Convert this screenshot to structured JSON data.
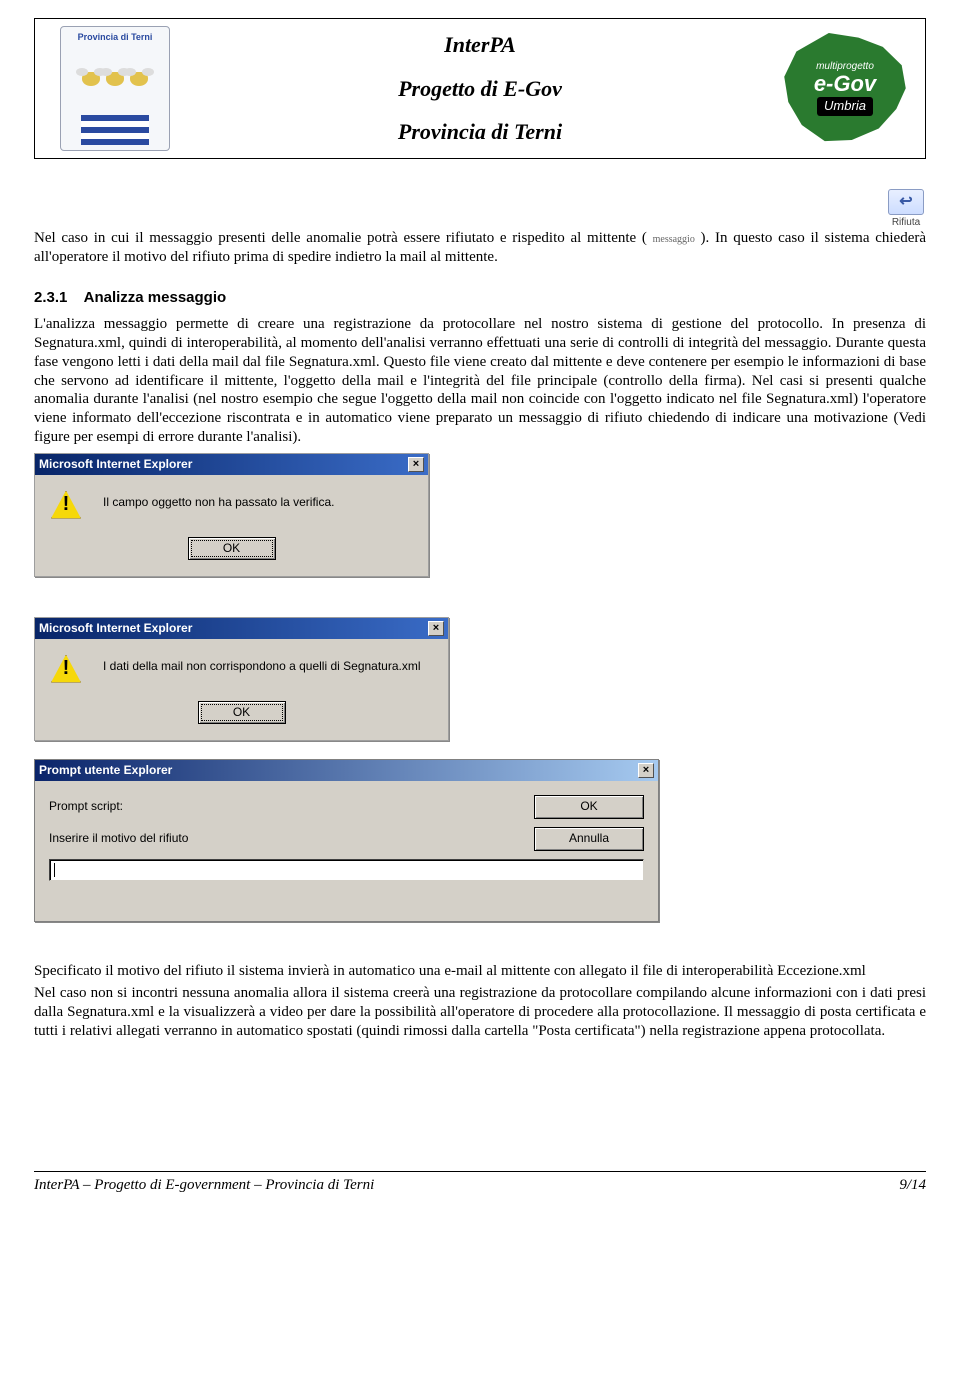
{
  "header": {
    "crest_label": "Provincia di Terni",
    "title1": "InterPA",
    "title2": "Progetto di E-Gov",
    "title3": "Provincia di Terni",
    "egov_top": "multiprogetto",
    "egov_main": "e-Gov",
    "egov_sub": "Umbria"
  },
  "rifiuta": {
    "label": "Rifiuta",
    "sub": "messaggio"
  },
  "intro": {
    "pre": "Nel caso in cui il messaggio presenti delle anomalie potrà essere rifiutato e rispedito al mittente ( ",
    "post": " ). In questo caso il sistema chiederà all'operatore il motivo del rifiuto prima di spedire indietro la mail al mittente."
  },
  "section": {
    "num": "2.3.1",
    "title": "Analizza messaggio",
    "body": "L'analizza messaggio permette di creare una registrazione da protocollare nel nostro sistema di gestione del protocollo. In presenza di Segnatura.xml, quindi di interoperabilità, al momento dell'analisi verranno effettuati una serie di controlli di integrità del messaggio. Durante questa fase vengono letti i dati della mail dal file Segnatura.xml. Questo file viene creato dal mittente e deve contenere per esempio le informazioni di base che servono ad identificare il mittente, l'oggetto della mail e l'integrità del file principale (controllo della firma). Nel casi si presenti qualche anomalia durante l'analisi (nel nostro esempio che segue l'oggetto della mail non coincide con l'oggetto indicato nel file Segnatura.xml) l'operatore viene informato dell'eccezione riscontrata e in automatico viene preparato un messaggio di rifiuto chiedendo di indicare una motivazione (Vedi figure per esempi di errore durante l'analisi)."
  },
  "dialog1": {
    "title": "Microsoft Internet Explorer",
    "message": "Il campo oggetto non ha passato la verifica.",
    "ok": "OK"
  },
  "dialog2": {
    "title": "Microsoft Internet Explorer",
    "message": "I dati della mail non corrispondono a quelli di Segnatura.xml",
    "ok": "OK"
  },
  "dialog3": {
    "title": "Prompt utente Explorer",
    "label1": "Prompt script:",
    "label2": "Inserire il motivo del rifiuto",
    "ok": "OK",
    "cancel": "Annulla",
    "input_value": ""
  },
  "after": {
    "p1": "Specificato il motivo del rifiuto il sistema invierà in automatico una e-mail al mittente con allegato il file di interoperabilità Eccezione.xml",
    "p2": "Nel caso non si incontri nessuna anomalia allora il sistema creerà una registrazione da protocollare compilando alcune informazioni con i dati presi dalla Segnatura.xml e la visualizzerà a video per dare la possibilità all'operatore di procedere alla protocollazione. Il messaggio di posta certificata e tutti i relativi allegati verranno in automatico spostati (quindi rimossi dalla cartella \"Posta certificata\") nella registrazione appena protocollata."
  },
  "footer": {
    "left": "InterPA – Progetto di E-government – Provincia di Terni",
    "right": "9/14"
  }
}
